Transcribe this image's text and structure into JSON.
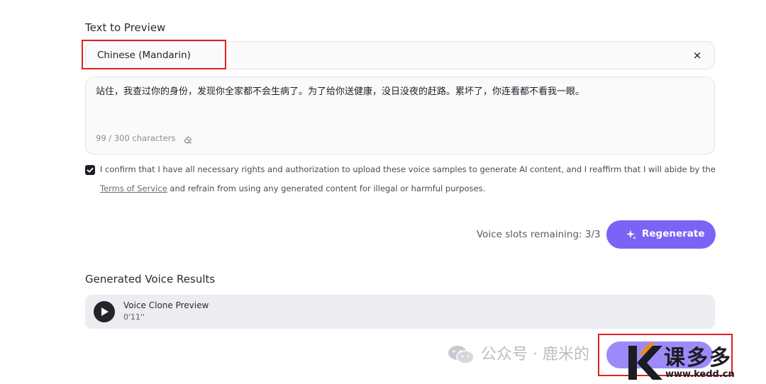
{
  "preview": {
    "section_title": "Text to Preview",
    "language_value": "Chinese (Mandarin)",
    "clear_symbol": "×",
    "text": "站住，我查过你的身份，发现你全家都不会生病了。为了给你送健康，没日没夜的赶路。累坏了，你连看都不看我一眼。",
    "char_count": "99 / 300 characters"
  },
  "consent": {
    "line1": "I confirm that I have all necessary rights and authorization to upload these voice samples to generate AI content, and I reaffirm that I will abide by the",
    "terms_link": "Terms of Service",
    "line2_rest": " and refrain from using any generated content for illegal or harmful purposes.",
    "checked": true
  },
  "actions": {
    "slots_remaining": "Voice slots remaining: 3/3",
    "regenerate_label": "Regenerate"
  },
  "results": {
    "section_title": "Generated Voice Results",
    "items": [
      {
        "title": "Voice Clone Preview",
        "duration": "0'11''"
      }
    ]
  },
  "watermark": {
    "wechat_text": "公众号 · 鹿米的",
    "kedd_text": "课多多",
    "kedd_url": "www.kedd.cn"
  },
  "colors": {
    "accent": "#7c63f6",
    "highlight_box": "#e02020"
  },
  "icons": {
    "clear": "close-icon",
    "eraser": "eraser-icon",
    "checkbox": "check-icon",
    "regenerate": "sparkle-icon",
    "play": "play-icon"
  }
}
